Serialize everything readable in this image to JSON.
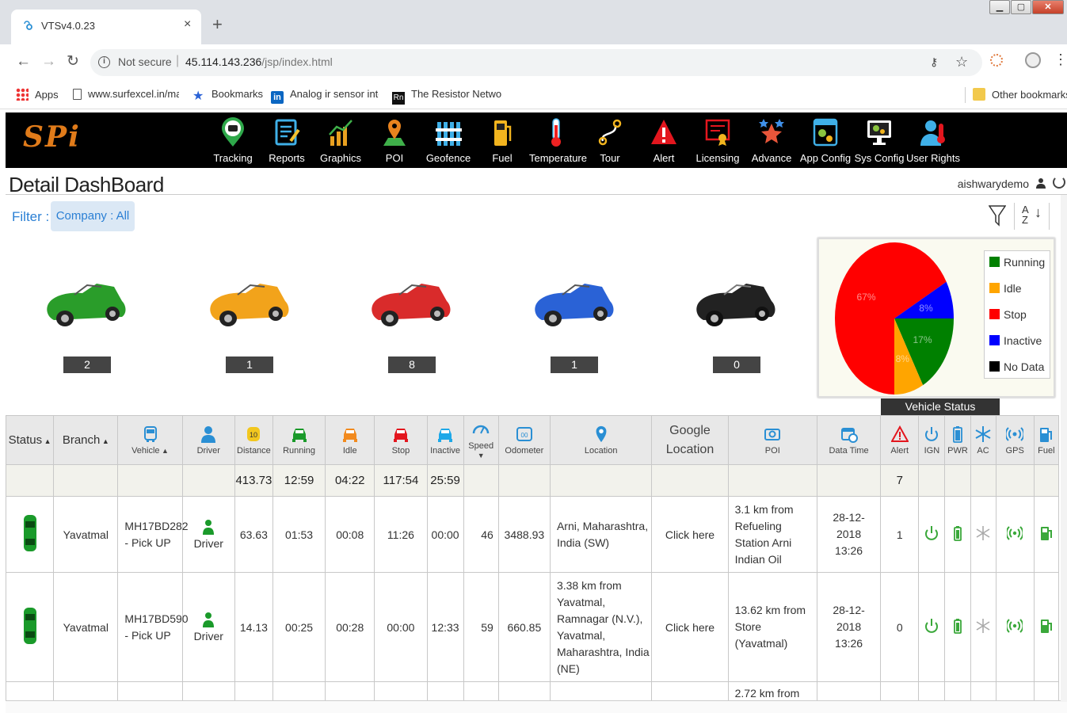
{
  "browser": {
    "tab_title": "VTSv4.0.23",
    "not_secure": "Not secure",
    "url_host": "45.114.143.236",
    "url_path": "/jsp/index.html"
  },
  "bookmarks": {
    "apps": "Apps",
    "b1": "www.surfexcel.in/mat",
    "b2": "Bookmarks",
    "b3": "Analog ir sensor inte",
    "b4": "The Resistor Network",
    "other": "Other bookmarks"
  },
  "app": {
    "logo": "SPi",
    "nav": [
      {
        "label": "Tracking"
      },
      {
        "label": "Reports"
      },
      {
        "label": "Graphics"
      },
      {
        "label": "POI"
      },
      {
        "label": "Geofence"
      },
      {
        "label": "Fuel"
      },
      {
        "label": "Temperature"
      },
      {
        "label": "Tour"
      },
      {
        "label": "Alert"
      },
      {
        "label": "Licensing"
      },
      {
        "label": "Advance"
      },
      {
        "label": "App Config"
      },
      {
        "label": "Sys Config"
      },
      {
        "label": "User Rights"
      }
    ],
    "page_title": "Detail DashBoard",
    "user": "aishwarydemo"
  },
  "filter": {
    "label": "Filter :",
    "chip": "Company : All"
  },
  "status_counts": [
    {
      "color": "#2a9d2a",
      "count": "2"
    },
    {
      "color": "#f2a31b",
      "count": "1"
    },
    {
      "color": "#d92b2b",
      "count": "8"
    },
    {
      "color": "#2a62d6",
      "count": "1"
    },
    {
      "color": "#222222",
      "count": "0"
    }
  ],
  "chart_data": {
    "type": "pie",
    "title": "Vehicle Status",
    "slices": [
      {
        "label": "Running",
        "value": 17,
        "color": "#008000",
        "text": "17%"
      },
      {
        "label": "Idle",
        "value": 8,
        "color": "#ffa500",
        "text": "8%"
      },
      {
        "label": "Stop",
        "value": 67,
        "color": "#ff0000",
        "text": "67%"
      },
      {
        "label": "Inactive",
        "value": 8,
        "color": "#0000ff",
        "text": "8%"
      },
      {
        "label": "No Data",
        "value": 0,
        "color": "#000000",
        "text": ""
      }
    ],
    "legend": [
      "Running",
      "Idle",
      "Stop",
      "Inactive",
      "No Data"
    ]
  },
  "table": {
    "headers": {
      "status": "Status",
      "branch": "Branch",
      "vehicle": "Vehicle",
      "driver": "Driver",
      "distance": "Distance",
      "running": "Running",
      "idle": "Idle",
      "stop": "Stop",
      "inactive": "Inactive",
      "speed": "Speed",
      "odometer": "Odometer",
      "location": "Location",
      "google_1": "Google",
      "google_2": "Location",
      "poi": "POI",
      "datetime": "Data Time",
      "alert": "Alert",
      "ign": "IGN",
      "pwr": "PWR",
      "ac": "AC",
      "gps": "GPS",
      "fuel": "Fuel"
    },
    "totals": {
      "distance": "413.73",
      "running": "12:59",
      "idle": "04:22",
      "stop": "117:54",
      "inactive": "25:59",
      "alert": "7"
    },
    "rows": [
      {
        "branch": "Yavatmal",
        "vehicle": "MH17BD282 - Pick UP",
        "driver": "Driver",
        "distance": "63.63",
        "running": "01:53",
        "idle": "00:08",
        "stop": "11:26",
        "inactive": "00:00",
        "speed": "46",
        "odometer": "3488.93",
        "location": "Arni, Maharashtra, India (SW)",
        "google": "Click here",
        "poi": "3.1 km from Refueling Station Arni Indian Oil",
        "datetime": "28-12-2018 13:26",
        "alert": "1"
      },
      {
        "branch": "Yavatmal",
        "vehicle": "MH17BD590 - Pick UP",
        "driver": "Driver",
        "distance": "14.13",
        "running": "00:25",
        "idle": "00:28",
        "stop": "00:00",
        "inactive": "12:33",
        "speed": "59",
        "odometer": "660.85",
        "location": "3.38 km from Yavatmal, Ramnagar (N.V.), Yavatmal, Maharashtra, India (NE)",
        "google": "Click here",
        "poi": "13.62 km from Store (Yavatmal)",
        "datetime": "28-12-2018 13:26",
        "alert": "0"
      }
    ],
    "partial_row_poi": "2.72 km from"
  }
}
